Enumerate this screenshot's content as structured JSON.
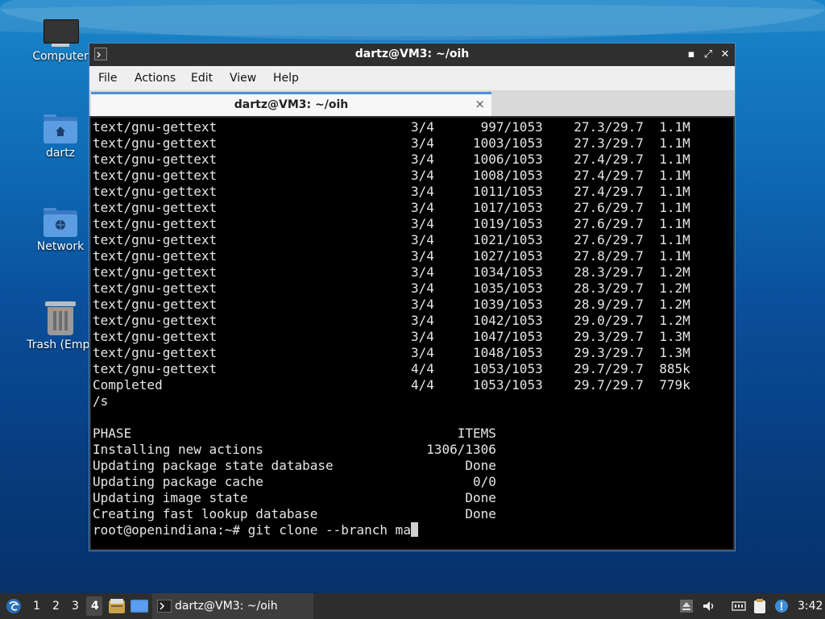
{
  "desktop": {
    "icons": [
      {
        "label": "Computer"
      },
      {
        "label": "dartz"
      },
      {
        "label": "Network"
      },
      {
        "label": "Trash (Empt"
      }
    ]
  },
  "window": {
    "title": "dartz@VM3: ~/oih",
    "menu": [
      "File",
      "Actions",
      "Edit",
      "View",
      "Help"
    ],
    "tab_label": "dartz@VM3: ~/oih",
    "tab_close": "×",
    "buttons": {
      "minimize": "▪",
      "maximize": "⤢",
      "close": "✕"
    }
  },
  "terminal": {
    "lines": [
      "text/gnu-gettext                         3/4      997/1053    27.3/29.7  1.1M",
      "text/gnu-gettext                         3/4     1003/1053    27.3/29.7  1.1M",
      "text/gnu-gettext                         3/4     1006/1053    27.4/29.7  1.1M",
      "text/gnu-gettext                         3/4     1008/1053    27.4/29.7  1.1M",
      "text/gnu-gettext                         3/4     1011/1053    27.4/29.7  1.1M",
      "text/gnu-gettext                         3/4     1017/1053    27.6/29.7  1.1M",
      "text/gnu-gettext                         3/4     1019/1053    27.6/29.7  1.1M",
      "text/gnu-gettext                         3/4     1021/1053    27.6/29.7  1.1M",
      "text/gnu-gettext                         3/4     1027/1053    27.8/29.7  1.1M",
      "text/gnu-gettext                         3/4     1034/1053    28.3/29.7  1.2M",
      "text/gnu-gettext                         3/4     1035/1053    28.3/29.7  1.2M",
      "text/gnu-gettext                         3/4     1039/1053    28.9/29.7  1.2M",
      "text/gnu-gettext                         3/4     1042/1053    29.0/29.7  1.2M",
      "text/gnu-gettext                         3/4     1047/1053    29.3/29.7  1.3M",
      "text/gnu-gettext                         3/4     1048/1053    29.3/29.7  1.3M",
      "text/gnu-gettext                         4/4     1053/1053    29.7/29.7  885k",
      "Completed                                4/4     1053/1053    29.7/29.7  779k",
      "/s",
      "",
      "PHASE                                          ITEMS",
      "Installing new actions                     1306/1306",
      "Updating package state database                 Done",
      "Updating package cache                           0/0",
      "Updating image state                            Done",
      "Creating fast lookup database                   Done"
    ],
    "prompt": "root@openindiana:~# git clone --branch ma"
  },
  "taskbar": {
    "workspaces": [
      "1",
      "2",
      "3",
      "4"
    ],
    "active_workspace": "4",
    "task_label": "dartz@VM3: ~/oih",
    "clock": "3:42"
  },
  "colors": {
    "window_border": "#4f88c6",
    "tab_accent": "#4d8fd6",
    "terminal_bg": "#000000",
    "terminal_fg": "#e6e6e6"
  }
}
